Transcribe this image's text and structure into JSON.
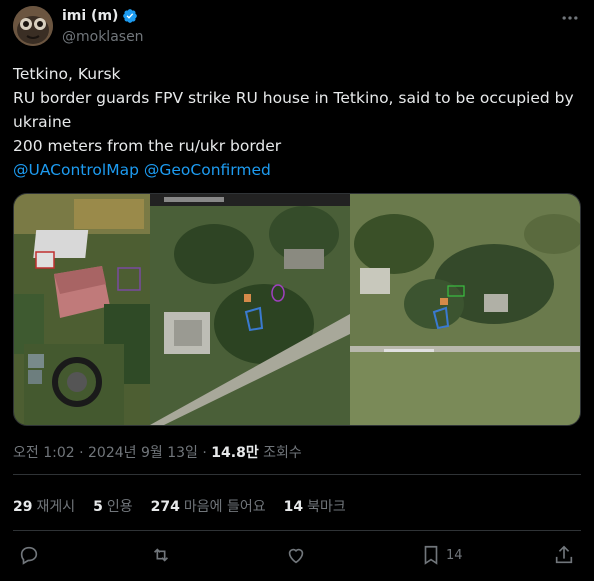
{
  "author": {
    "name": "imi (m)",
    "handle": "@moklasen"
  },
  "post": {
    "line1": "Tetkino, Kursk",
    "line2": "RU border guards FPV strike RU house in Tetkino, said to be occupied by",
    "line3": "ukraine",
    "line4": "200 meters from the ru/ukr border",
    "mention1": "@UAControlMap",
    "mention2": "@GeoConfirmed"
  },
  "meta": {
    "time": "오전 1:02",
    "date": "2024년 9월 13일",
    "views_value": "14.8만",
    "views_label": "조회수",
    "sep": "·"
  },
  "stats": [
    {
      "count": "29",
      "label": "재게시"
    },
    {
      "count": "5",
      "label": "인용"
    },
    {
      "count": "274",
      "label": "마음에 들어요"
    },
    {
      "count": "14",
      "label": "북마크"
    }
  ],
  "actions": {
    "bookmark_count": "14"
  },
  "icons": {
    "verified": "verified-badge-icon",
    "more": "more-icon",
    "reply": "reply-icon",
    "retweet": "retweet-icon",
    "like": "like-icon",
    "bookmark": "bookmark-icon",
    "share": "share-icon"
  },
  "colors": {
    "background": "#000000",
    "text": "#e7e9ea",
    "muted": "#71767b",
    "link": "#1d9bf0",
    "verified": "#1d9bf0"
  }
}
